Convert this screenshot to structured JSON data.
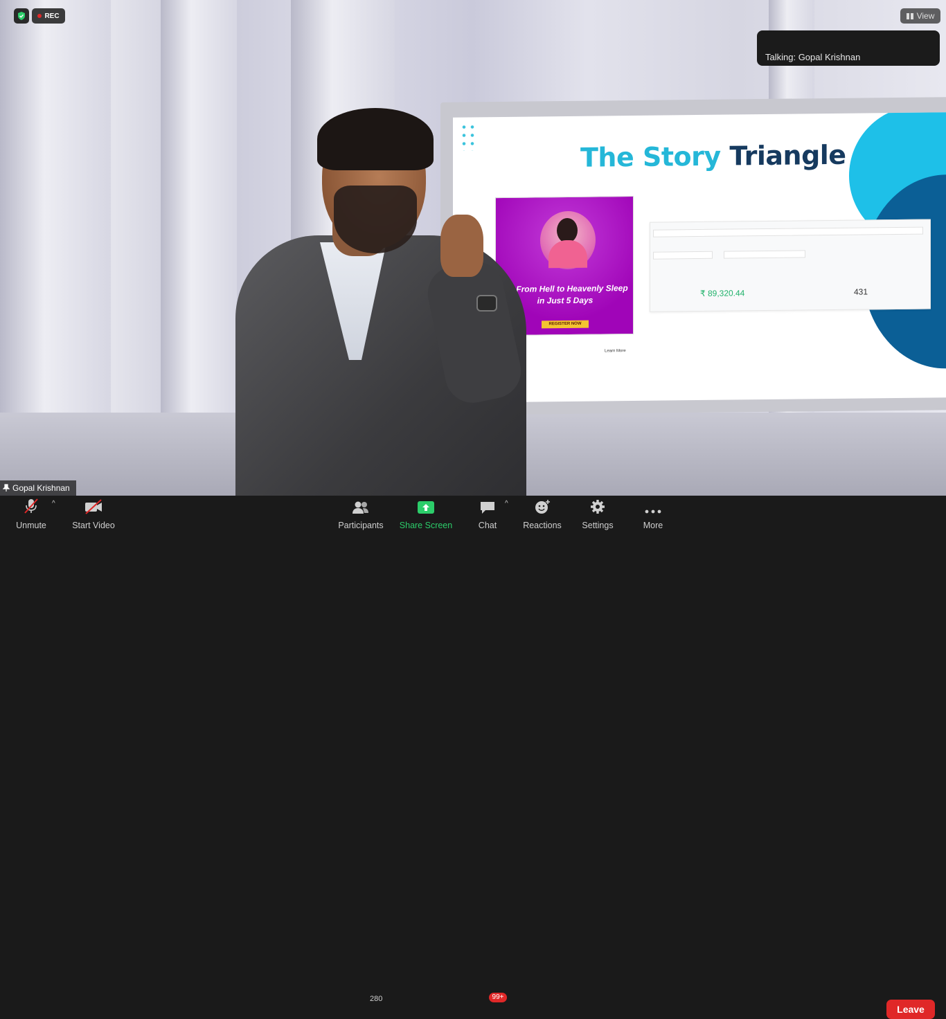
{
  "overlay": {
    "rec_label": "REC",
    "view_label": "View",
    "talking": "Talking: Gopal Krishnan",
    "speaker_name": "Gopal Krishnan"
  },
  "slide": {
    "title_part1": "The Story",
    "title_part2": "Triangle",
    "promo_headline": "Go From Hell to Heavenly Sleep in Just 5 Days",
    "promo_cta": "REGISTER NOW",
    "learn_more": "Learn More",
    "revenue": "₹ 89,320.44",
    "orders": "431"
  },
  "toolbar": {
    "unmute": "Unmute",
    "start_video": "Start Video",
    "participants": "Participants",
    "participants_count": "280",
    "share_screen": "Share Screen",
    "chat": "Chat",
    "chat_badge": "99+",
    "reactions": "Reactions",
    "settings": "Settings",
    "more": "More",
    "leave": "Leave"
  },
  "colors": {
    "accent_green": "#2ccd6a",
    "leave_red": "#e02828",
    "toolbar_bg": "#1a1a1a"
  }
}
